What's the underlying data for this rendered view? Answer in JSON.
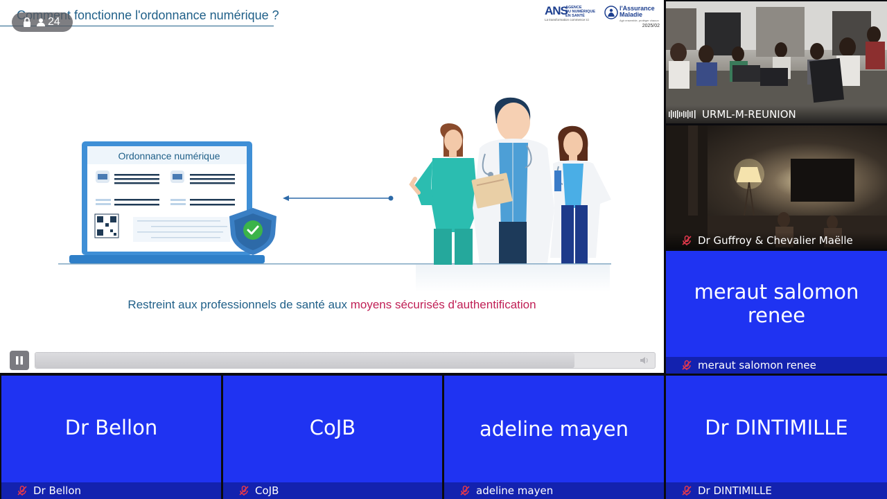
{
  "main_share": {
    "lock_badge": {
      "count": "24"
    },
    "slide": {
      "title": "Comment fonctionne l'ordonnance numérique ?",
      "logo_ans": {
        "letters": "ANS",
        "line1": "AGENCE",
        "line2": "DU NUMÉRIQUE",
        "line3": "EN SANTÉ",
        "tagline": "La transformation commence ici"
      },
      "logo_assurance_maladie": {
        "line1": "l'Assurance",
        "line2": "Maladie",
        "tagline": "Agir ensemble, protéger chacun"
      },
      "date": "2025/02",
      "laptop_screen_title": "Ordonnance numérique",
      "caption_part1": "Restreint aux professionnels de santé aux ",
      "caption_part2": "moyens sécurisés d'authentification"
    },
    "video_progress": 0.87
  },
  "participants": {
    "urml": {
      "name": "URML-M-REUNION"
    },
    "guffroy": {
      "name": "Dr Guffroy & Chevalier Maëlle"
    },
    "meraut": {
      "display": "meraut salomon renee",
      "name": "meraut salomon renee"
    },
    "bellon": {
      "display": "Dr Bellon",
      "name": "Dr Bellon"
    },
    "cojb": {
      "display": "CoJB",
      "name": "CoJB"
    },
    "adeline": {
      "display": "adeline mayen",
      "name": "adeline mayen"
    },
    "dintimille": {
      "display": "Dr DINTIMILLE",
      "name": "Dr DINTIMILLE"
    }
  },
  "colors": {
    "tile_blue": "#1f33f2",
    "slide_blue": "#1f5f88",
    "slide_highlight": "#c01f55",
    "muted_red": "#e2384d"
  }
}
